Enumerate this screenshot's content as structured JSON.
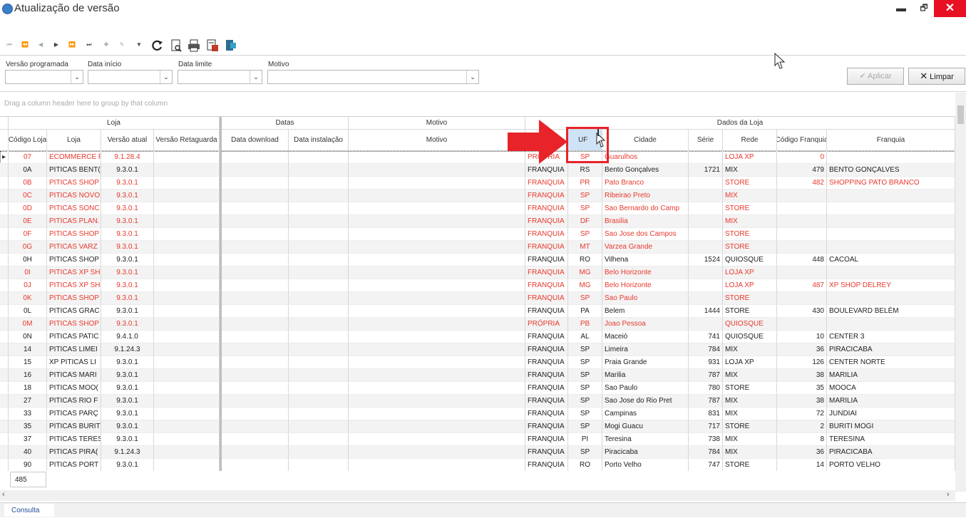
{
  "window": {
    "title": "Atualização de versão",
    "minimize": "▬",
    "restore": "🗗",
    "close": "✕"
  },
  "toolbar": {
    "nav": [
      "⏮",
      "⏪",
      "◀",
      "▶",
      "⏩",
      "⏭",
      "✚",
      "✎",
      "▼"
    ],
    "icons": [
      "refresh-icon",
      "preview-icon",
      "print-icon",
      "export-icon",
      "exit-icon"
    ]
  },
  "filters": {
    "versao_label": "Versão programada",
    "inicio_label": "Data início",
    "limite_label": "Data limite",
    "motivo_label": "Motivo",
    "versao_value": "",
    "inicio_value": "",
    "limite_value": "",
    "motivo_value": ""
  },
  "buttons": {
    "aplicar": "Aplicar",
    "limpar": "Limpar"
  },
  "group_panel": "Drag a column header here to group by that column",
  "bands": {
    "loja": "Loja",
    "datas": "Datas",
    "motivo": "Motivo",
    "dados": "Dados da Loja"
  },
  "headers": {
    "codigo": "Código Loja",
    "loja": "Loja",
    "versao_atual": "Versão atual",
    "versao_ret": "Versão Retaguarda",
    "data_download": "Data download",
    "data_instalacao": "Data instalação",
    "motivo": "Motivo",
    "tipo": "",
    "uf": "UF",
    "cidade": "Cidade",
    "serie": "Série",
    "rede": "Rede",
    "codigo_franquia": "Código Franquia",
    "franquia": "Franquia"
  },
  "rows": [
    {
      "codigo": "07",
      "loja": "ECOMMERCE F",
      "versao": "9.1.28.4",
      "tipo": "PRÓPRIA",
      "uf": "SP",
      "cidade": "Guarulhos",
      "serie": "",
      "rede": "LOJA XP",
      "codfr": "0",
      "franquia": "",
      "red": true,
      "selected": true
    },
    {
      "codigo": "0A",
      "loja": "PITICAS BENT(",
      "versao": "9.3.0.1",
      "tipo": "FRANQUIA",
      "uf": "RS",
      "cidade": "Bento Gonçalves",
      "serie": "1721",
      "rede": "MIX",
      "codfr": "479",
      "franquia": "BENTO GONÇALVES",
      "red": false
    },
    {
      "codigo": "0B",
      "loja": "PITICAS SHOP",
      "versao": "9.3.0.1",
      "tipo": "FRANQUIA",
      "uf": "PR",
      "cidade": "Pato Branco",
      "serie": "",
      "rede": "STORE",
      "codfr": "482",
      "franquia": "SHOPPING PATO BRANCO",
      "red": true
    },
    {
      "codigo": "0C",
      "loja": "PITICAS NOVO",
      "versao": "9.3.0.1",
      "tipo": "FRANQUIA",
      "uf": "SP",
      "cidade": "Ribeirao Preto",
      "serie": "",
      "rede": "MIX",
      "codfr": "",
      "franquia": "",
      "red": true
    },
    {
      "codigo": "0D",
      "loja": "PITICAS SONC",
      "versao": "9.3.0.1",
      "tipo": "FRANQUIA",
      "uf": "SP",
      "cidade": "Sao Bernardo do Camp",
      "serie": "",
      "rede": "STORE",
      "codfr": "",
      "franquia": "",
      "red": true
    },
    {
      "codigo": "0E",
      "loja": "PITICAS PLAN.",
      "versao": "9.3.0.1",
      "tipo": "FRANQUIA",
      "uf": "DF",
      "cidade": "Brasilia",
      "serie": "",
      "rede": "MIX",
      "codfr": "",
      "franquia": "",
      "red": true
    },
    {
      "codigo": "0F",
      "loja": "PITICAS SHOP",
      "versao": "9.3.0.1",
      "tipo": "FRANQUIA",
      "uf": "SP",
      "cidade": "Sao Jose dos Campos",
      "serie": "",
      "rede": "STORE",
      "codfr": "",
      "franquia": "",
      "red": true
    },
    {
      "codigo": "0G",
      "loja": "PITICAS VARZ",
      "versao": "9.3.0.1",
      "tipo": "FRANQUIA",
      "uf": "MT",
      "cidade": "Varzea Grande",
      "serie": "",
      "rede": "STORE",
      "codfr": "",
      "franquia": "",
      "red": true
    },
    {
      "codigo": "0H",
      "loja": "PITICAS SHOP",
      "versao": "9.3.0.1",
      "tipo": "FRANQUIA",
      "uf": "RO",
      "cidade": "Vilhena",
      "serie": "1524",
      "rede": "QUIOSQUE",
      "codfr": "448",
      "franquia": "CACOAL",
      "red": false
    },
    {
      "codigo": "0I",
      "loja": "PITICAS XP SH",
      "versao": "9.3.0.1",
      "tipo": "FRANQUIA",
      "uf": "MG",
      "cidade": "Belo Horizonte",
      "serie": "",
      "rede": "LOJA XP",
      "codfr": "",
      "franquia": "",
      "red": true
    },
    {
      "codigo": "0J",
      "loja": "PITICAS XP SH",
      "versao": "9.3.0.1",
      "tipo": "FRANQUIA",
      "uf": "MG",
      "cidade": "Belo Horizonte",
      "serie": "",
      "rede": "LOJA XP",
      "codfr": "487",
      "franquia": "XP SHOP DELREY",
      "red": true
    },
    {
      "codigo": "0K",
      "loja": "PITICAS SHOP",
      "versao": "9.3.0.1",
      "tipo": "FRANQUIA",
      "uf": "SP",
      "cidade": "Sao Paulo",
      "serie": "",
      "rede": "STORE",
      "codfr": "",
      "franquia": "",
      "red": true
    },
    {
      "codigo": "0L",
      "loja": "PITICAS GRAC",
      "versao": "9.3.0.1",
      "tipo": "FRANQUIA",
      "uf": "PA",
      "cidade": "Belem",
      "serie": "1444",
      "rede": "STORE",
      "codfr": "430",
      "franquia": "BOULEVARD BELÉM",
      "red": false
    },
    {
      "codigo": "0M",
      "loja": "PITICAS SHOP",
      "versao": "9.3.0.1",
      "tipo": "PRÓPRIA",
      "uf": "PB",
      "cidade": "Joao Pessoa",
      "serie": "",
      "rede": "QUIOSQUE",
      "codfr": "",
      "franquia": "",
      "red": true
    },
    {
      "codigo": "0N",
      "loja": "PITICAS PATIC",
      "versao": "9.4.1.0",
      "tipo": "FRANQUIA",
      "uf": "AL",
      "cidade": "Maceió",
      "serie": "741",
      "rede": "QUIOSQUE",
      "codfr": "10",
      "franquia": "CENTER 3",
      "red": false
    },
    {
      "codigo": "14",
      "loja": "PITICAS LIMEI",
      "versao": "9.1.24.3",
      "tipo": "FRANQUIA",
      "uf": "SP",
      "cidade": "Limeira",
      "serie": "784",
      "rede": "MIX",
      "codfr": "36",
      "franquia": "PIRACICABA",
      "red": false
    },
    {
      "codigo": "15",
      "loja": "XP PITICAS LI",
      "versao": "9.3.0.1",
      "tipo": "FRANQUIA",
      "uf": "SP",
      "cidade": "Praia Grande",
      "serie": "931",
      "rede": "LOJA XP",
      "codfr": "126",
      "franquia": "CENTER NORTE",
      "red": false
    },
    {
      "codigo": "16",
      "loja": "PITICAS MARI",
      "versao": "9.3.0.1",
      "tipo": "FRANQUIA",
      "uf": "SP",
      "cidade": "Marilia",
      "serie": "787",
      "rede": "MIX",
      "codfr": "38",
      "franquia": "MARILIA",
      "red": false
    },
    {
      "codigo": "18",
      "loja": "PITICAS MOO(",
      "versao": "9.3.0.1",
      "tipo": "FRANQUIA",
      "uf": "SP",
      "cidade": "Sao Paulo",
      "serie": "780",
      "rede": "STORE",
      "codfr": "35",
      "franquia": "MOOCA",
      "red": false
    },
    {
      "codigo": "27",
      "loja": "PITICAS RIO F",
      "versao": "9.3.0.1",
      "tipo": "FRANQUIA",
      "uf": "SP",
      "cidade": "Sao Jose do Rio Pret",
      "serie": "787",
      "rede": "MIX",
      "codfr": "38",
      "franquia": "MARILIA",
      "red": false
    },
    {
      "codigo": "33",
      "loja": "PITICAS PARÇ",
      "versao": "9.3.0.1",
      "tipo": "FRANQUIA",
      "uf": "SP",
      "cidade": "Campinas",
      "serie": "831",
      "rede": "MIX",
      "codfr": "72",
      "franquia": "JUNDIAI",
      "red": false
    },
    {
      "codigo": "35",
      "loja": "PITICAS BURIT",
      "versao": "9.3.0.1",
      "tipo": "FRANQUIA",
      "uf": "SP",
      "cidade": "Mogi Guacu",
      "serie": "717",
      "rede": "STORE",
      "codfr": "2",
      "franquia": "BURITI MOGI",
      "red": false
    },
    {
      "codigo": "37",
      "loja": "PITICAS TERES",
      "versao": "9.3.0.1",
      "tipo": "FRANQUIA",
      "uf": "PI",
      "cidade": "Teresina",
      "serie": "738",
      "rede": "MIX",
      "codfr": "8",
      "franquia": "TERESINA",
      "red": false
    },
    {
      "codigo": "40",
      "loja": "PITICAS PIRA(",
      "versao": "9.1.24.3",
      "tipo": "FRANQUIA",
      "uf": "SP",
      "cidade": "Piracicaba",
      "serie": "784",
      "rede": "MIX",
      "codfr": "36",
      "franquia": "PIRACICABA",
      "red": false
    },
    {
      "codigo": "90",
      "loja": "PITICAS PORT",
      "versao": "9.3.0.1",
      "tipo": "FRANQUIA",
      "uf": "RO",
      "cidade": "Porto Velho",
      "serie": "747",
      "rede": "STORE",
      "codfr": "14",
      "franquia": "PORTO VELHO",
      "red": false
    }
  ],
  "footer": {
    "count": "485",
    "tab": "Consulta"
  },
  "colors": {
    "red_text": "#e8392d",
    "highlight": "#e8232a",
    "uf_header_bg": "#cfe3f7"
  }
}
